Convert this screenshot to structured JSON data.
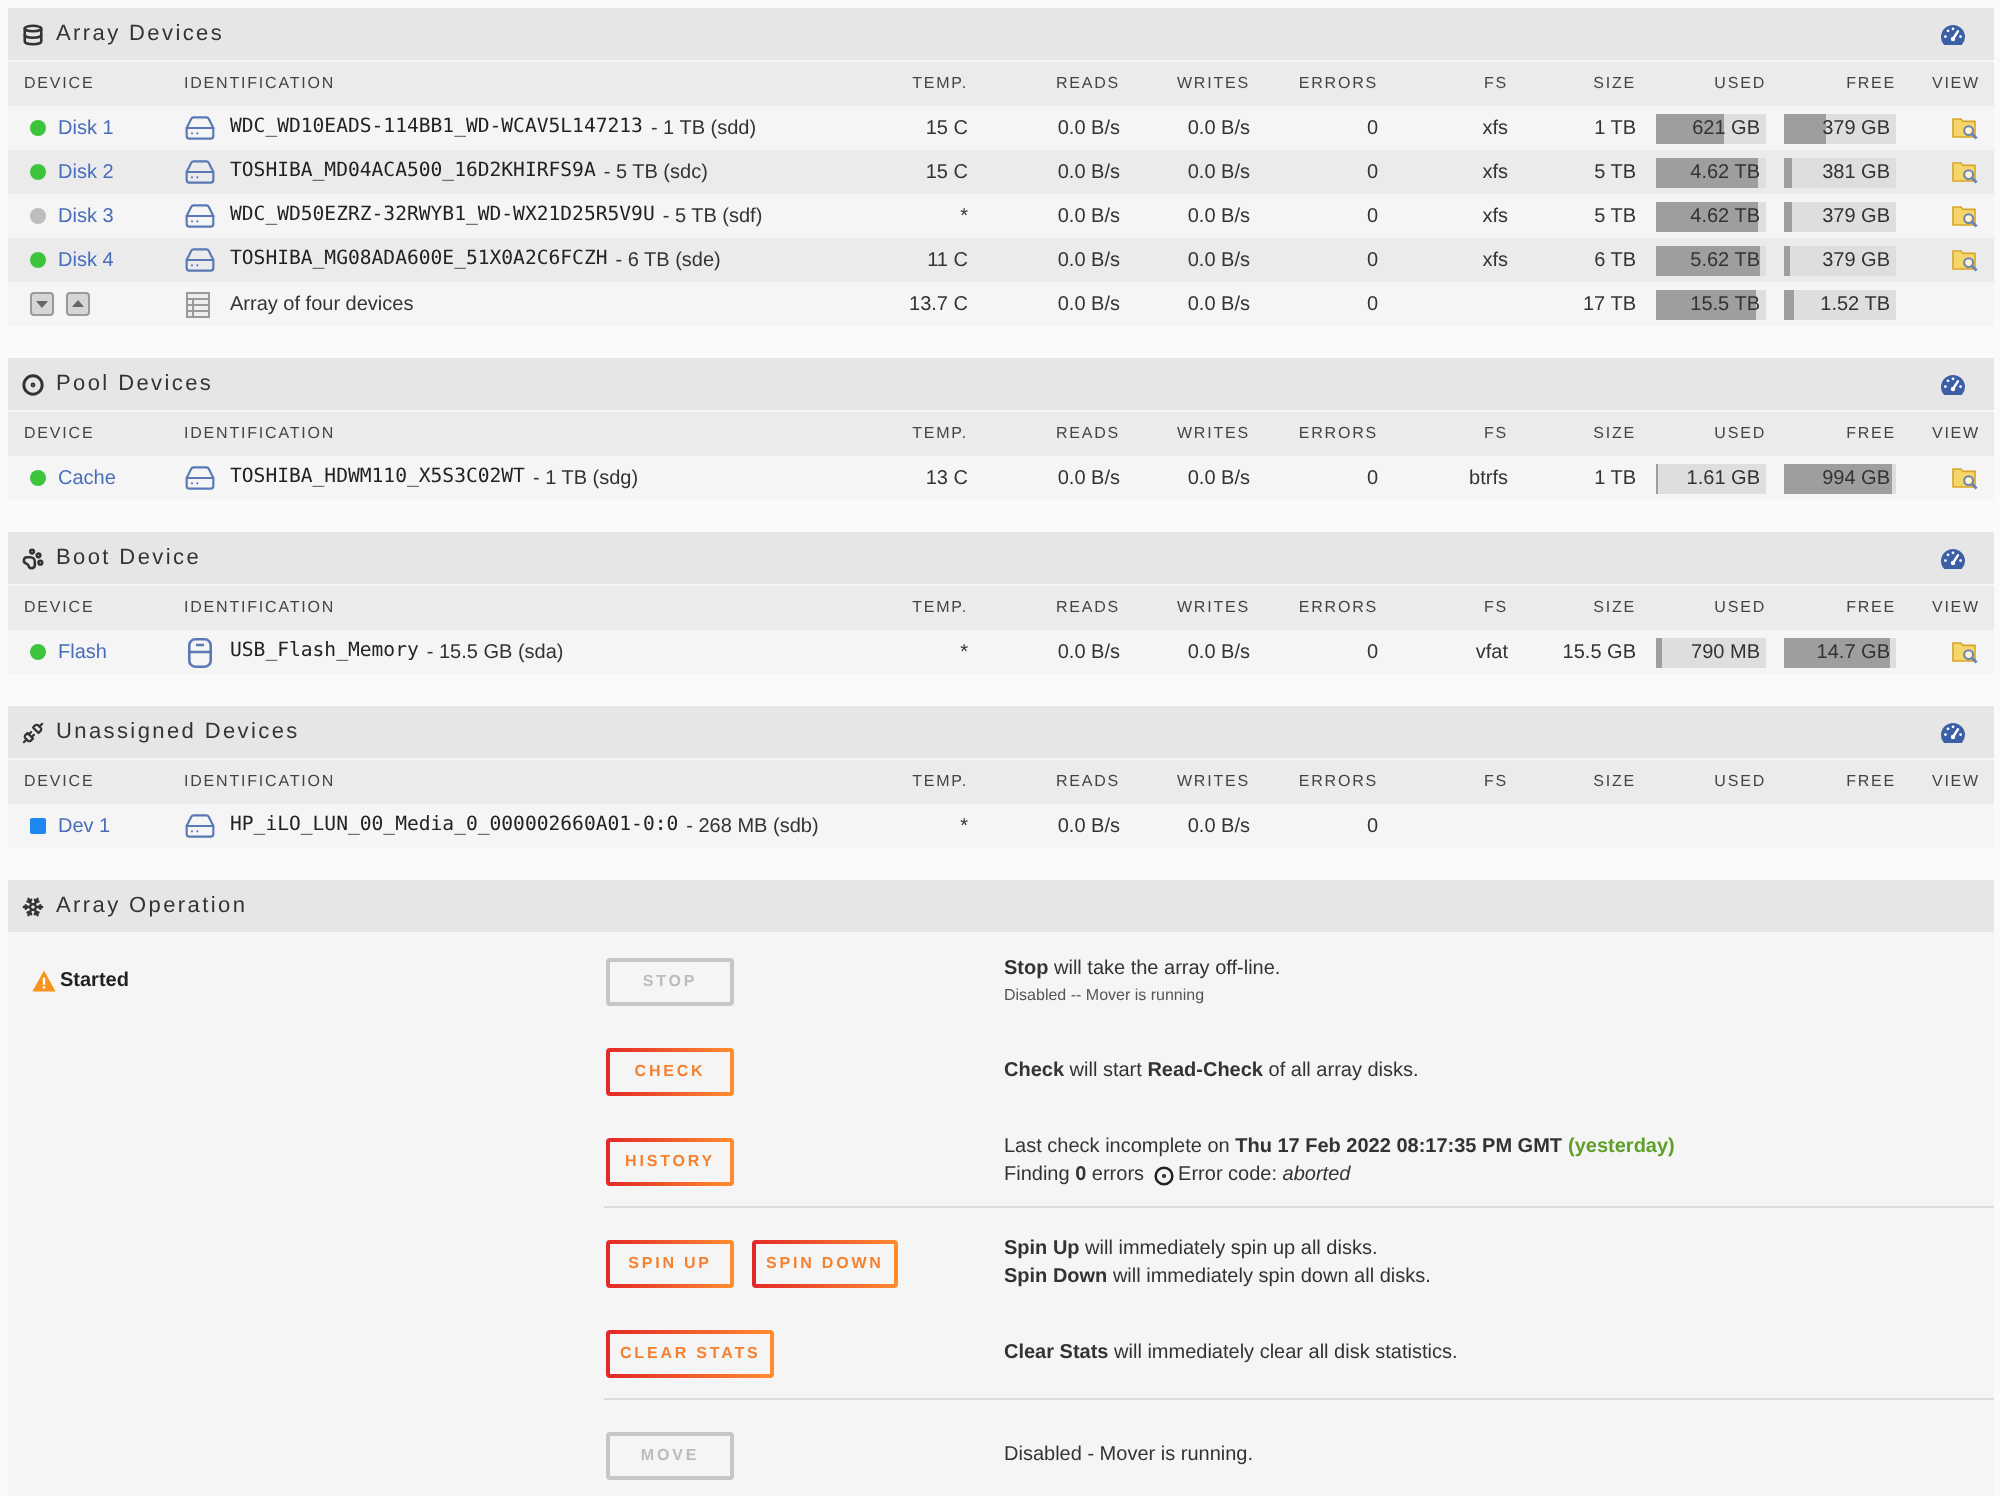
{
  "sections": [
    {
      "kind": "array",
      "title": "Array Devices",
      "columns": [
        "DEVICE",
        "IDENTIFICATION",
        "TEMP.",
        "READS",
        "WRITES",
        "ERRORS",
        "FS",
        "SIZE",
        "USED",
        "FREE",
        "VIEW"
      ],
      "rows": [
        {
          "kind": "disk",
          "device": "Disk 1",
          "color": "#3cc43c",
          "model": "WDC_WD10EADS-114BB1_WD-WCAV5L147213",
          "detail": "- 1 TB (sdd)",
          "temp": "15 C",
          "reads": "0.0 B/s",
          "writes": "0.0 B/s",
          "errors": "0",
          "fs": "xfs",
          "size": "1 TB",
          "used": {
            "text": "621 GB",
            "level": 0.62
          },
          "free": {
            "text": "379 GB",
            "level": 0.38
          },
          "view": true
        },
        {
          "kind": "disk",
          "device": "Disk 2",
          "color": "#3cc43c",
          "model": "TOSHIBA_MD04ACA500_16D2KHIRFS9A",
          "detail": "- 5 TB (sdc)",
          "temp": "15 C",
          "reads": "0.0 B/s",
          "writes": "0.0 B/s",
          "errors": "0",
          "fs": "xfs",
          "size": "5 TB",
          "used": {
            "text": "4.62 TB",
            "level": 0.92
          },
          "free": {
            "text": "381 GB",
            "level": 0.08
          },
          "view": true
        },
        {
          "kind": "disk",
          "device": "Disk 3",
          "color": "#bdbdbd",
          "model": "WDC_WD50EZRZ-32RWYB1_WD-WX21D25R5V9U",
          "detail": "- 5 TB (sdf)",
          "temp": "*",
          "reads": "0.0 B/s",
          "writes": "0.0 B/s",
          "errors": "0",
          "fs": "xfs",
          "size": "5 TB",
          "used": {
            "text": "4.62 TB",
            "level": 0.92
          },
          "free": {
            "text": "379 GB",
            "level": 0.08
          },
          "view": true
        },
        {
          "kind": "disk",
          "device": "Disk 4",
          "color": "#3cc43c",
          "model": "TOSHIBA_MG08ADA600E_51X0A2C6FCZH",
          "detail": "- 6 TB (sde)",
          "temp": "11 C",
          "reads": "0.0 B/s",
          "writes": "0.0 B/s",
          "errors": "0",
          "fs": "xfs",
          "size": "6 TB",
          "used": {
            "text": "5.62 TB",
            "level": 0.94
          },
          "free": {
            "text": "379 GB",
            "level": 0.06
          },
          "view": true
        },
        {
          "kind": "summary",
          "label": "Array of four devices",
          "temp": "13.7 C",
          "reads": "0.0 B/s",
          "writes": "0.0 B/s",
          "errors": "0",
          "size": "17 TB",
          "used": {
            "text": "15.5 TB",
            "level": 0.91
          },
          "free": {
            "text": "1.52 TB",
            "level": 0.09
          }
        }
      ]
    },
    {
      "kind": "pool",
      "title": "Pool Devices",
      "columns": [
        "DEVICE",
        "IDENTIFICATION",
        "TEMP.",
        "READS",
        "WRITES",
        "ERRORS",
        "FS",
        "SIZE",
        "USED",
        "FREE",
        "VIEW"
      ],
      "rows": [
        {
          "kind": "disk",
          "device": "Cache",
          "color": "#3cc43c",
          "model": "TOSHIBA_HDWM110_X5S3C02WT",
          "detail": "- 1 TB (sdg)",
          "temp": "13 C",
          "reads": "0.0 B/s",
          "writes": "0.0 B/s",
          "errors": "0",
          "fs": "btrfs",
          "size": "1 TB",
          "used": {
            "text": "1.61 GB",
            "level": 0.02
          },
          "free": {
            "text": "994 GB",
            "level": 0.96
          },
          "view": true
        }
      ]
    },
    {
      "kind": "boot",
      "title": "Boot Device",
      "columns": [
        "DEVICE",
        "IDENTIFICATION",
        "TEMP.",
        "READS",
        "WRITES",
        "ERRORS",
        "FS",
        "SIZE",
        "USED",
        "FREE",
        "VIEW"
      ],
      "rows": [
        {
          "kind": "flash",
          "device": "Flash",
          "color": "#3cc43c",
          "model": "USB_Flash_Memory",
          "detail": "- 15.5 GB (sda)",
          "temp": "*",
          "reads": "0.0 B/s",
          "writes": "0.0 B/s",
          "errors": "0",
          "fs": "vfat",
          "size": "15.5 GB",
          "used": {
            "text": "790 MB",
            "level": 0.05
          },
          "free": {
            "text": "14.7 GB",
            "level": 0.95
          },
          "view": true
        }
      ]
    },
    {
      "kind": "unassigned",
      "title": "Unassigned Devices",
      "columns": [
        "DEVICE",
        "IDENTIFICATION",
        "TEMP.",
        "READS",
        "WRITES",
        "ERRORS",
        "FS",
        "SIZE",
        "USED",
        "FREE",
        "VIEW"
      ],
      "rows": [
        {
          "kind": "disk",
          "device": "Dev 1",
          "color": "#1e88f0",
          "model": "HP_iLO_LUN_00_Media_0_000002660A01-0:0",
          "detail": "- 268 MB (sdb)",
          "temp": "*",
          "reads": "0.0 B/s",
          "writes": "0.0 B/s",
          "errors": "0",
          "view": false
        }
      ]
    }
  ],
  "operation": {
    "kind": "operation",
    "title": "Array Operation",
    "status": "Started",
    "actions": [
      {
        "kind": "plain",
        "buttons": [
          {
            "label": "STOP",
            "disabled": true
          }
        ],
        "lines": [
          "**Stop** will take the array off-line."
        ],
        "note": "Disabled -- Mover is running",
        "divider": false
      },
      {
        "kind": "plain",
        "buttons": [
          {
            "label": "CHECK",
            "disabled": false
          }
        ],
        "lines": [
          "**Check** will start **Read-Check** of all array disks."
        ],
        "divider": false
      },
      {
        "kind": "history",
        "buttons": [
          {
            "label": "HISTORY",
            "disabled": false
          }
        ],
        "last_check": "Last check incomplete on **Thu 17 Feb 2022 08:17:35 PM GMT**",
        "when": "(yesterday)",
        "finding": "Finding **0** errors",
        "error_code": "Error code: *aborted*",
        "divider": true
      },
      {
        "kind": "plain",
        "buttons": [
          {
            "label": "SPIN UP",
            "disabled": false
          },
          {
            "label": "SPIN DOWN",
            "disabled": false
          }
        ],
        "lines": [
          "**Spin Up** will immediately spin up all disks.",
          "**Spin Down** will immediately spin down all disks."
        ],
        "divider": false
      },
      {
        "kind": "plain",
        "buttons": [
          {
            "label": "CLEAR STATS",
            "disabled": false
          }
        ],
        "lines": [
          "**Clear Stats** will immediately clear all disk statistics."
        ],
        "divider": true
      },
      {
        "kind": "plain",
        "buttons": [
          {
            "label": "MOVE",
            "disabled": true
          }
        ],
        "lines": [
          "Disabled - Mover is running."
        ],
        "divider": false
      }
    ]
  }
}
